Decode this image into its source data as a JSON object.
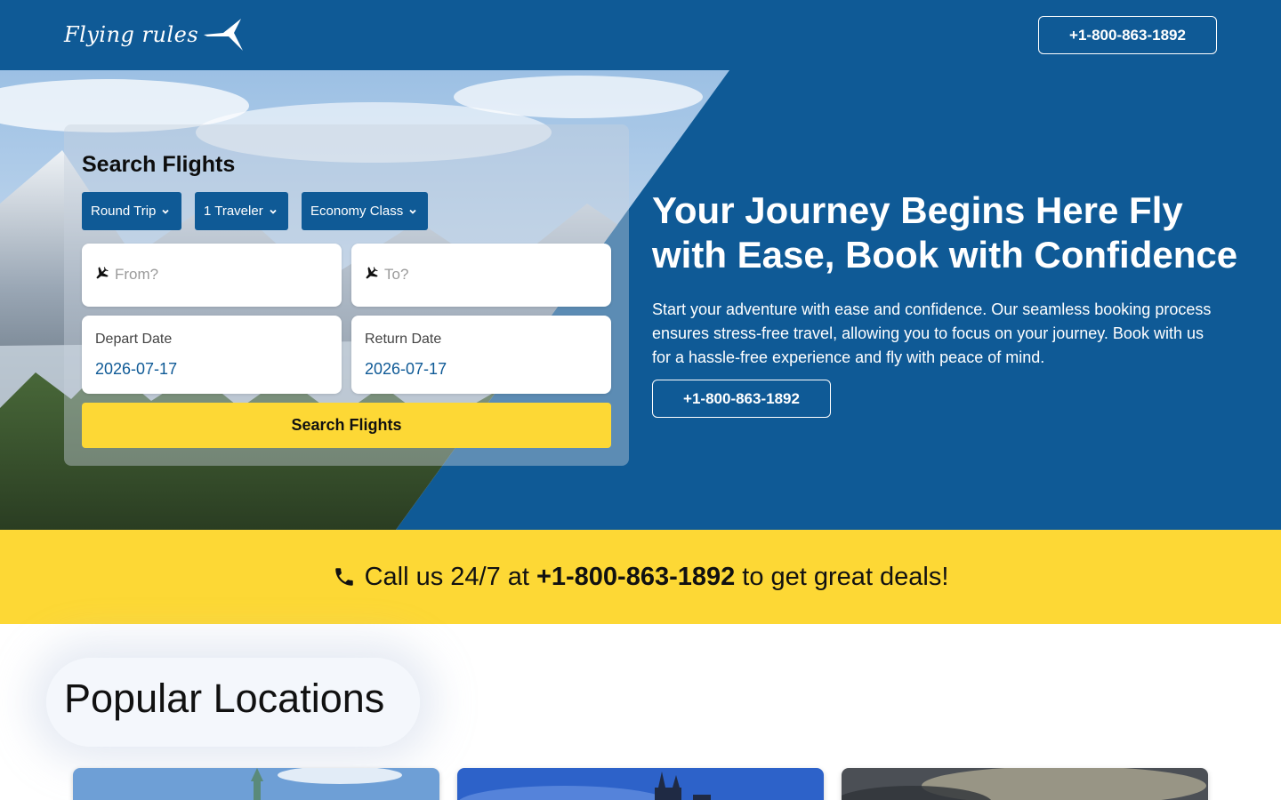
{
  "header": {
    "logo_text": "Flying rules",
    "phone": "+1-800-863-1892"
  },
  "search": {
    "title": "Search Flights",
    "trip_type": "Round Trip",
    "travelers": "1 Traveler",
    "cabin_class": "Economy Class",
    "from_placeholder": "From?",
    "to_placeholder": "To?",
    "depart_label": "Depart Date",
    "depart_value": "2026-07-17",
    "return_label": "Return Date",
    "return_value": "2026-07-17",
    "submit_label": "Search Flights"
  },
  "hero": {
    "title": "Your Journey Begins Here Fly with Ease, Book with Confidence",
    "description": "Start your adventure with ease and confidence. Our seamless booking process ensures stress-free travel, allowing you to focus on your journey. Book with us for a hassle-free experience and fly with peace of mind.",
    "phone": "+1-800-863-1892"
  },
  "banner": {
    "prefix": "Call us 24/7 at",
    "phone": "+1-800-863-1892",
    "suffix": "to get great deals!"
  },
  "popular": {
    "title": "Popular Locations"
  },
  "colors": {
    "primary": "#0f5a96",
    "accent": "#fdd835"
  },
  "icons": {
    "logo": "plane-logo-icon",
    "field": "plane-icon",
    "dropdown": "chevron-down-icon",
    "banner": "phone-icon"
  }
}
